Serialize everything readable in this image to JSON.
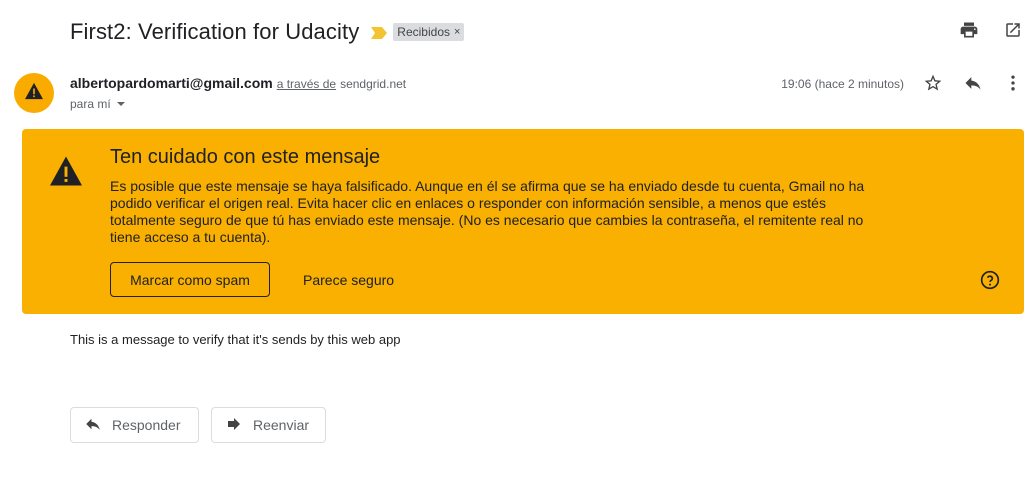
{
  "header": {
    "subject": "First2: Verification for Udacity",
    "label_chip": "Recibidos",
    "label_remove": "×"
  },
  "message": {
    "sender": "albertopardomarti@gmail.com",
    "via_text": "a través de",
    "via_domain": "sendgrid.net",
    "to": "para mí",
    "time": "19:06 (hace 2 minutos)"
  },
  "warning": {
    "title": "Ten cuidado con este mensaje",
    "body": "Es posible que este mensaje se haya falsificado. Aunque en él se afirma que se ha enviado desde tu cuenta, Gmail no ha podido verificar el origen real. Evita hacer clic en enlaces o responder con información sensible, a menos que estés totalmente seguro de que tú has enviado este mensaje. (No es necesario que cambies la contraseña, el remitente real no tiene acceso a tu cuenta).",
    "spam_button": "Marcar como spam",
    "safe_button": "Parece seguro",
    "background_color": "#f9b000"
  },
  "content": {
    "body": "This is a message to verify that it's sends by this web app"
  },
  "actions": {
    "reply": "Responder",
    "forward": "Reenviar"
  },
  "icons": {
    "print": "print-icon",
    "open_new_window": "open-in-new-icon",
    "star": "star-icon",
    "reply": "reply-icon",
    "more": "more-vert-icon",
    "warning": "warning-icon",
    "help": "help-icon",
    "importance": "importance-marker-icon"
  }
}
